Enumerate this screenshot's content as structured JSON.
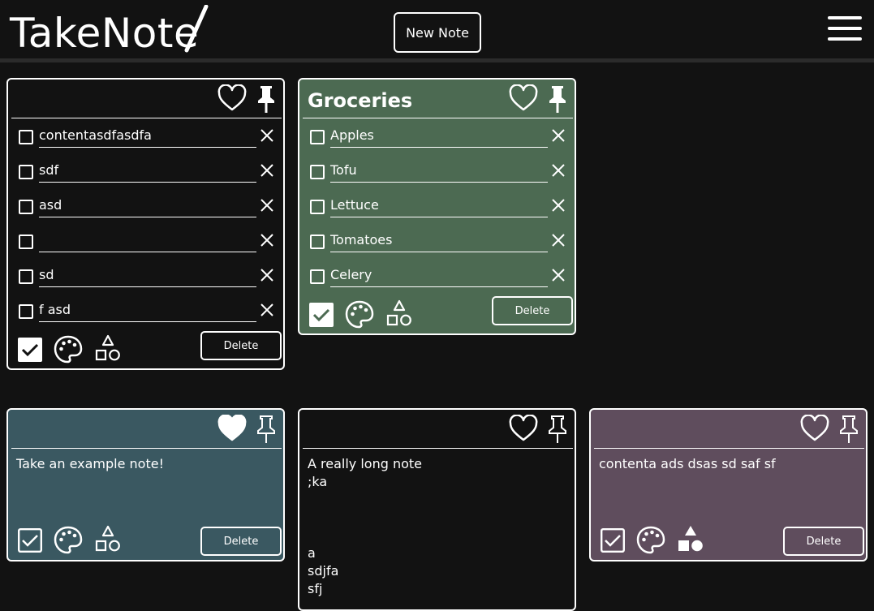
{
  "app": {
    "logo": "TakeNote",
    "new_note_label": "New Note"
  },
  "colors": {
    "background": "#121212",
    "note_default": "#121212",
    "note_green": "#4c6a52",
    "note_teal": "#3a5861",
    "note_mauve": "#5f4d5d"
  },
  "notes": [
    {
      "title": "",
      "favorited": false,
      "items": [
        {
          "text": "contentasdfasdfa"
        },
        {
          "text": "sdf"
        },
        {
          "text": "asd"
        },
        {
          "text": ""
        },
        {
          "text": "sd"
        },
        {
          "text": "f asd"
        }
      ],
      "delete_label": "Delete"
    },
    {
      "title": "Groceries",
      "favorited": false,
      "items": [
        {
          "text": "Apples"
        },
        {
          "text": "Tofu"
        },
        {
          "text": "Lettuce"
        },
        {
          "text": "Tomatoes"
        },
        {
          "text": "Celery"
        }
      ],
      "delete_label": "Delete"
    },
    {
      "title": "",
      "favorited": true,
      "body": "Take an example note!",
      "delete_label": "Delete"
    },
    {
      "title": "",
      "favorited": false,
      "body": "A really long note\n;ka\n\n\n\na\nsdjfa\nsfj",
      "delete_label": "Delete"
    },
    {
      "title": "",
      "favorited": false,
      "body": "contenta ads dsas sd saf sf",
      "delete_label": "Delete"
    }
  ],
  "icons": {
    "favorite": "heart-icon",
    "pin": "pin-icon",
    "checkbox": "checkbox-icon",
    "remove": "close-icon",
    "list_mode": "checkbox-checked-icon",
    "color": "palette-icon",
    "shapes": "shapes-icon",
    "menu": "hamburger-menu-icon"
  }
}
